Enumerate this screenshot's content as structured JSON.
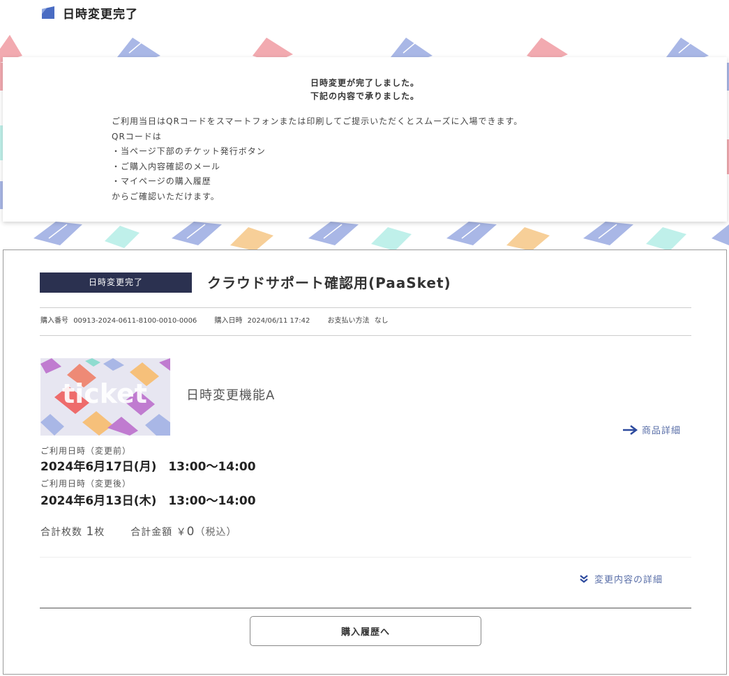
{
  "page": {
    "heading": "日時変更完了"
  },
  "notice": {
    "title_line1": "日時変更が完了しました。",
    "title_line2": "下記の内容で承りました。",
    "body_lines": [
      "ご利用当日はQRコードをスマートフォンまたは印刷してご提示いただくとスムーズに入場できます。",
      "QRコードは",
      "・当ページ下部のチケット発行ボタン",
      "・ご購入内容確認のメール",
      "・マイページの購入履歴",
      "からご確認いただけます。"
    ]
  },
  "order": {
    "status_badge": "日時変更完了",
    "event_title": "クラウドサポート確認用(PaaSket)",
    "purchase_number_label": "購入番号",
    "purchase_number": "00913-2024-0611-8100-0010-0006",
    "purchase_date_label": "購入日時",
    "purchase_date": "2024/06/11 17:42",
    "payment_method_label": "お支払い方法",
    "payment_method": "なし",
    "thumbnail_text": "ticket",
    "product_name": "日時変更機能A",
    "product_detail_link": "商品詳細",
    "date_before_label": "ご利用日時（変更前）",
    "date_before": "2024年6月17日(月)　13:00〜14:00",
    "date_after_label": "ご利用日時（変更後）",
    "date_after": "2024年6月13日(木)　13:00〜14:00",
    "total_count_label": "合計枚数",
    "total_count": "1",
    "total_count_unit": "枚",
    "total_amount_label": "合計金額",
    "total_amount_currency": "￥",
    "total_amount": "0",
    "total_amount_tax": "（税込）",
    "change_details_link": "変更内容の詳細",
    "history_button": "購入履歴へ"
  },
  "colors": {
    "accent_blue": "#4a6cc3",
    "badge_bg": "#2b3150",
    "link": "#5a6fa8",
    "pattern_pink": "#f2aab0",
    "pattern_blue": "#a9b7e6",
    "pattern_mint": "#bff0ea",
    "pattern_orange": "#f7cf98"
  },
  "icons": {
    "heading": "square-flag-icon",
    "detail": "arrow-right-icon",
    "changes": "double-chevron-down-icon"
  }
}
